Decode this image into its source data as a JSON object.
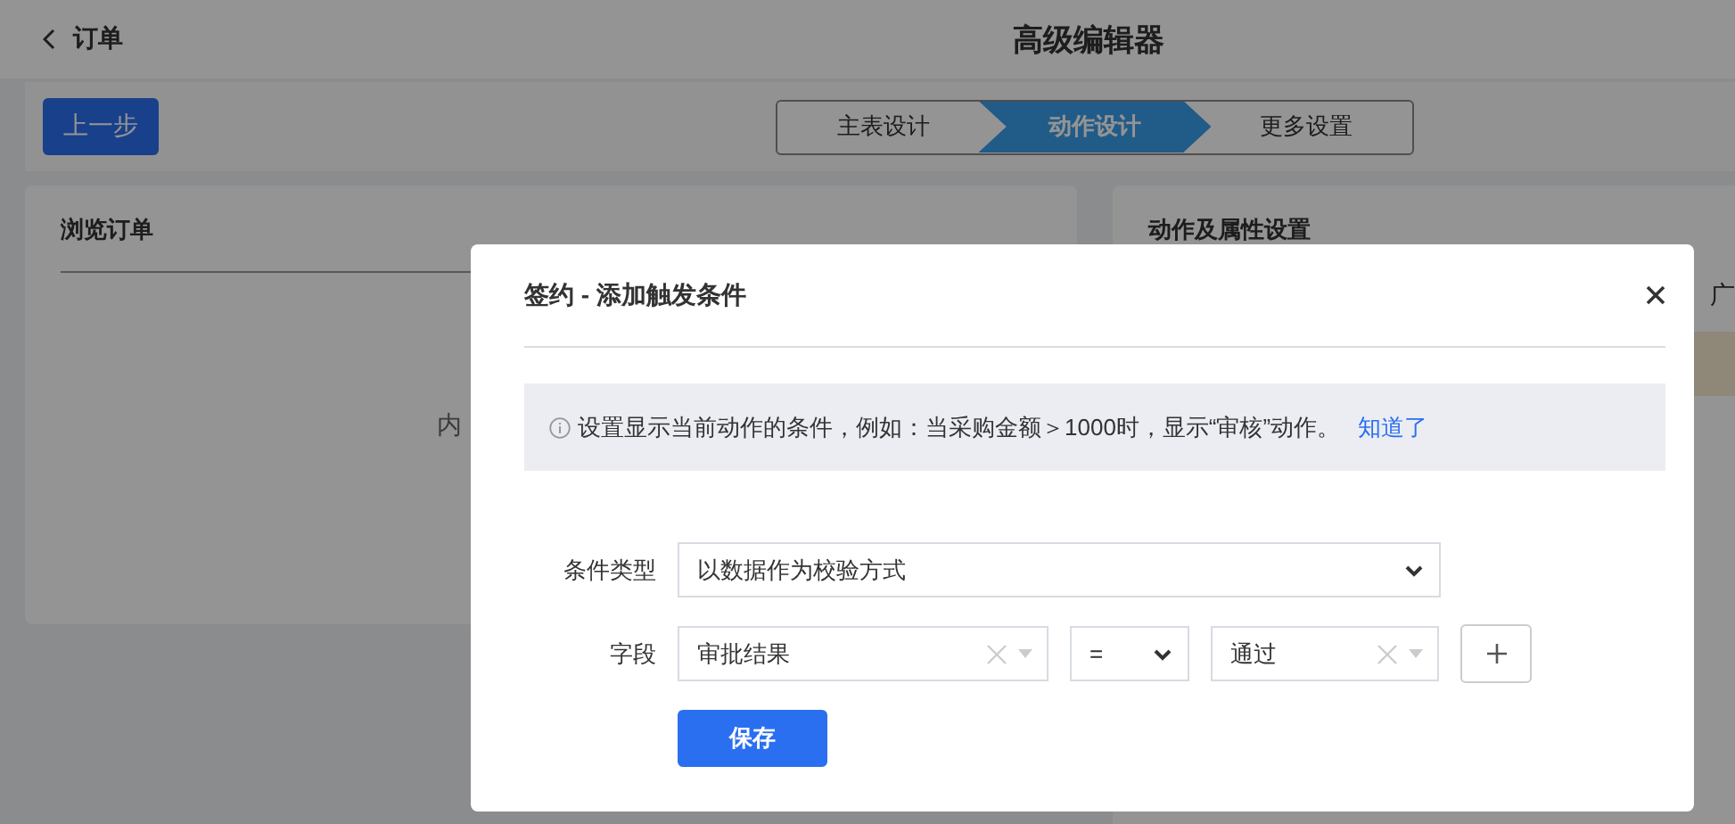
{
  "header": {
    "back_label": "订单",
    "title": "高级编辑器"
  },
  "toolbar": {
    "back_button": "上一步",
    "steps": [
      {
        "label": "主表设计",
        "selected": false
      },
      {
        "label": "动作设计",
        "selected": true
      },
      {
        "label": "更多设置",
        "selected": false
      }
    ]
  },
  "left_panel": {
    "title": "浏览订单",
    "empty_text": "内"
  },
  "right_panel": {
    "title": "动作及属性设置",
    "column_text": "广"
  },
  "dialog": {
    "title": "签约 - 添加触发条件",
    "notice": {
      "text": "设置显示当前动作的条件，例如：当采购金额＞1000时，显示“审核”动作。",
      "link": "知道了"
    },
    "condition_type": {
      "label": "条件类型",
      "value": "以数据作为校验方式"
    },
    "field_row": {
      "label": "字段",
      "field": "审批结果",
      "operator": "=",
      "value": "通过"
    },
    "save_button": "保存"
  }
}
